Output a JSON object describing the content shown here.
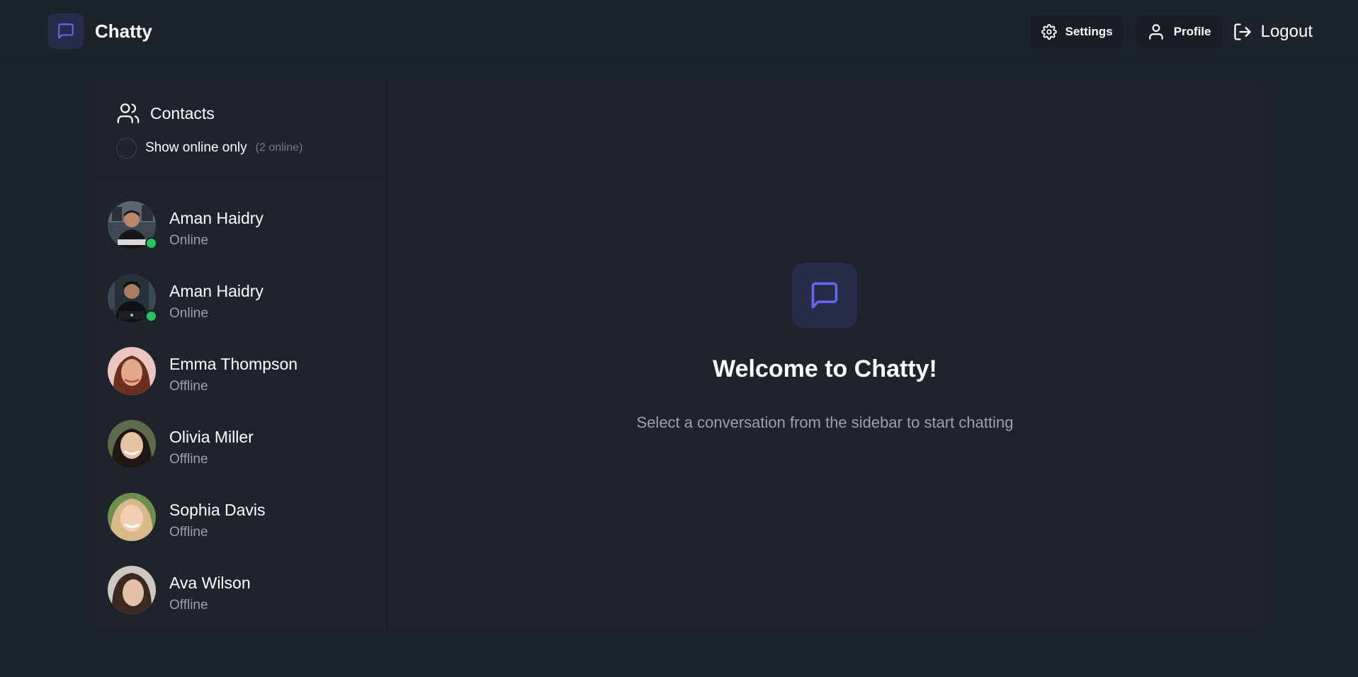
{
  "brand": {
    "name": "Chatty",
    "icon": "message-square-icon"
  },
  "nav": {
    "settings_label": "Settings",
    "profile_label": "Profile",
    "logout_label": "Logout"
  },
  "sidebar": {
    "title": "Contacts",
    "filter_label": "Show online only",
    "online_count": "(2 online)",
    "contacts": [
      {
        "name": "Aman Haidry",
        "status": "Online",
        "online": true
      },
      {
        "name": "Aman Haidry",
        "status": "Online",
        "online": true
      },
      {
        "name": "Emma Thompson",
        "status": "Offline",
        "online": false
      },
      {
        "name": "Olivia Miller",
        "status": "Offline",
        "online": false
      },
      {
        "name": "Sophia Davis",
        "status": "Offline",
        "online": false
      },
      {
        "name": "Ava Wilson",
        "status": "Offline",
        "online": false
      }
    ]
  },
  "welcome": {
    "title": "Welcome to Chatty!",
    "subtitle": "Select a conversation from the sidebar to start chatting"
  },
  "colors": {
    "accent": "#6366f1",
    "online": "#22c55e",
    "background": "#1d232a",
    "card": "#1f242c"
  }
}
